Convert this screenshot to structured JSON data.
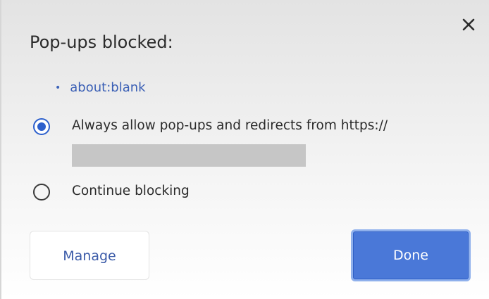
{
  "dialog": {
    "title": "Pop-ups blocked:",
    "close_icon": "close-icon",
    "blocked_items": [
      {
        "bullet": "•",
        "label": "about:blank"
      }
    ],
    "options": [
      {
        "label": "Always allow pop-ups and redirects from https://",
        "checked": true
      },
      {
        "label": "Continue blocking",
        "checked": false
      }
    ],
    "buttons": {
      "manage": "Manage",
      "done": "Done"
    }
  },
  "colors": {
    "accent": "#2c5fcc",
    "link": "#3a5fb5",
    "primary_button": "#4a78d8"
  }
}
